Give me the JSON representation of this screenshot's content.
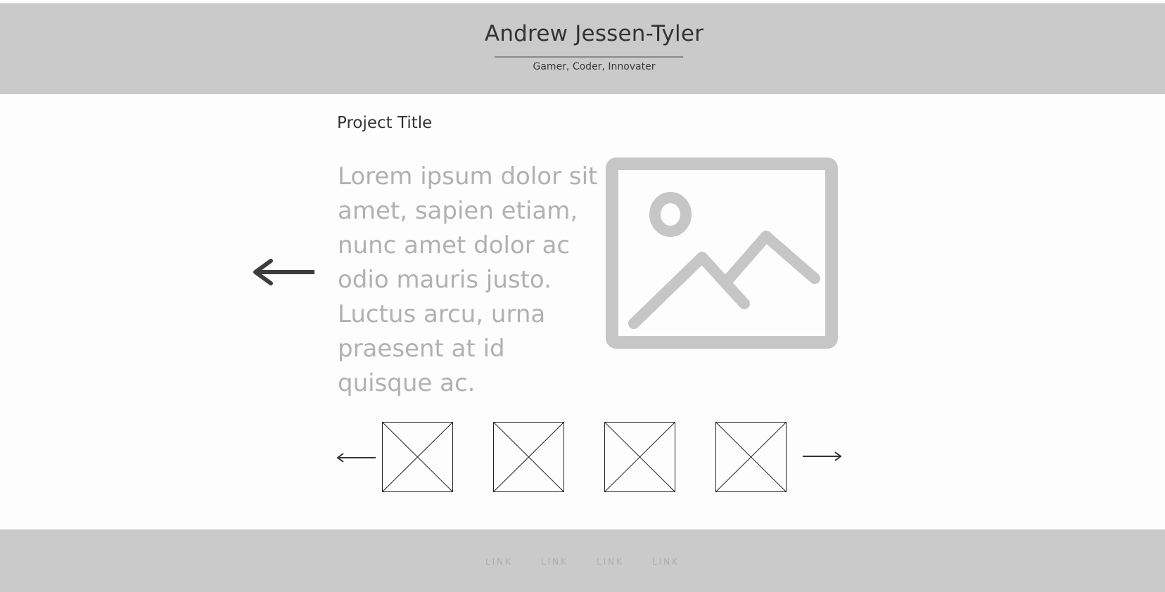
{
  "header": {
    "title": "Andrew Jessen-Tyler",
    "tagline": "Gamer, Coder, Innovater"
  },
  "project": {
    "title": "Project Title",
    "description": "Lorem ipsum dolor sit amet, sapien etiam, nunc amet dolor ac odio mauris justo. Luctus arcu, urna praesent at id quisque ac."
  },
  "icons": {
    "prev_project": "arrow-left-icon",
    "hero": "image-placeholder-icon",
    "thumb_prev": "arrow-left-icon",
    "thumb_next": "arrow-right-icon",
    "thumbnail": "image-placeholder-icon"
  },
  "thumbnails": [
    {
      "icon": "image-placeholder-icon"
    },
    {
      "icon": "image-placeholder-icon"
    },
    {
      "icon": "image-placeholder-icon"
    },
    {
      "icon": "image-placeholder-icon"
    }
  ],
  "footer": {
    "links": [
      "LINK",
      "LINK",
      "LINK",
      "LINK"
    ]
  },
  "colors": {
    "header_bg": "#cacaca",
    "footer_bg": "#cacaca",
    "page_bg": "#fdfdfd",
    "placeholder_gray": "#c6c6c6",
    "dark_text": "#333333",
    "muted_text": "#b1b1b1"
  }
}
